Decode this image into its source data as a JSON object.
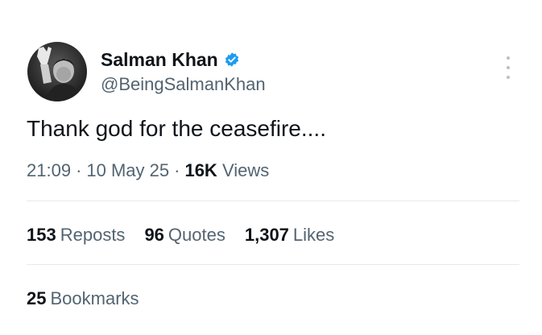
{
  "author": {
    "display_name": "Salman Khan",
    "handle": "@BeingSalmanKhan",
    "verified": true,
    "verified_icon": "verified-badge-icon",
    "verified_color": "#1d9bf0"
  },
  "tweet": {
    "text": "Thank god for the ceasefire....",
    "time": "21:09",
    "date": "10 May 25",
    "separator": "·",
    "views_count": "16K",
    "views_label": "Views"
  },
  "stats": {
    "reposts_count": "153",
    "reposts_label": "Reposts",
    "quotes_count": "96",
    "quotes_label": "Quotes",
    "likes_count": "1,307",
    "likes_label": "Likes",
    "bookmarks_count": "25",
    "bookmarks_label": "Bookmarks"
  },
  "colors": {
    "primary_text": "#0f1419",
    "secondary_text": "#536471",
    "divider": "#e6e9ec",
    "accent": "#1d9bf0"
  },
  "icons": {
    "more": "more-options-icon"
  }
}
